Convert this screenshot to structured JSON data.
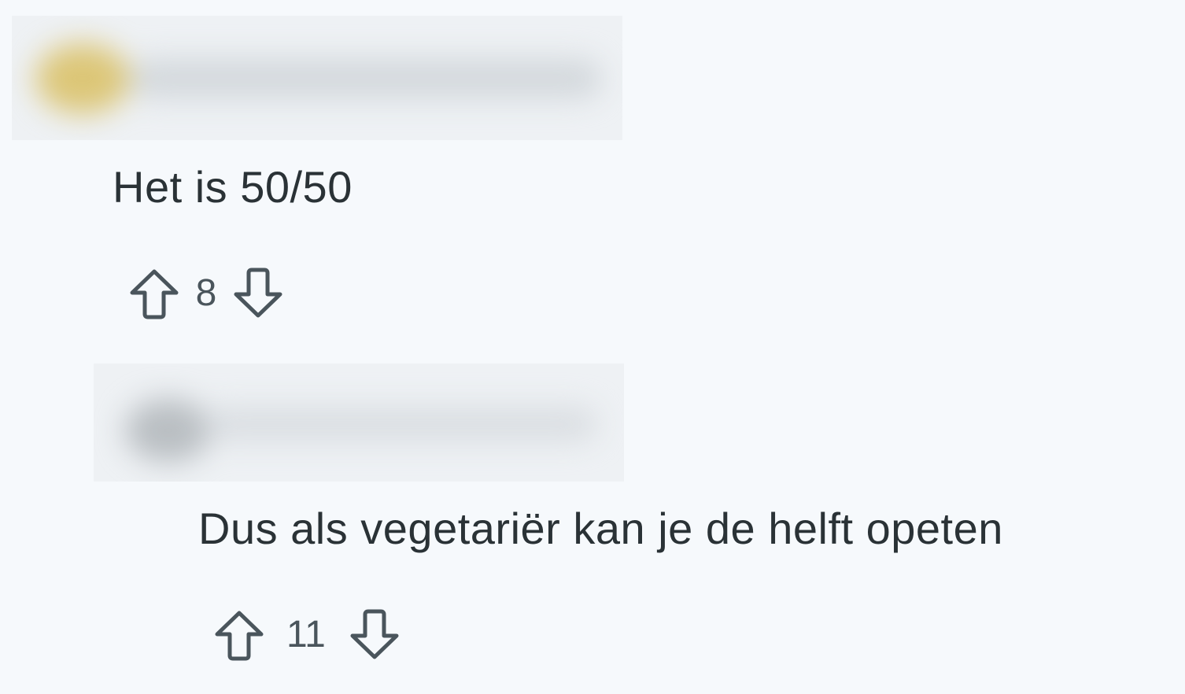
{
  "comments": [
    {
      "body": "Het is 50/50",
      "score": "8",
      "upvote_icon": "arrow-up-outline-icon",
      "downvote_icon": "arrow-down-outline-icon"
    },
    {
      "body": "Dus als vegetariër kan je de helft opeten",
      "score": "11",
      "upvote_icon": "arrow-up-outline-icon",
      "downvote_icon": "arrow-down-outline-icon"
    }
  ],
  "colors": {
    "background": "#f6f9fc",
    "text": "#2a3236",
    "icon": "#4a555c"
  }
}
